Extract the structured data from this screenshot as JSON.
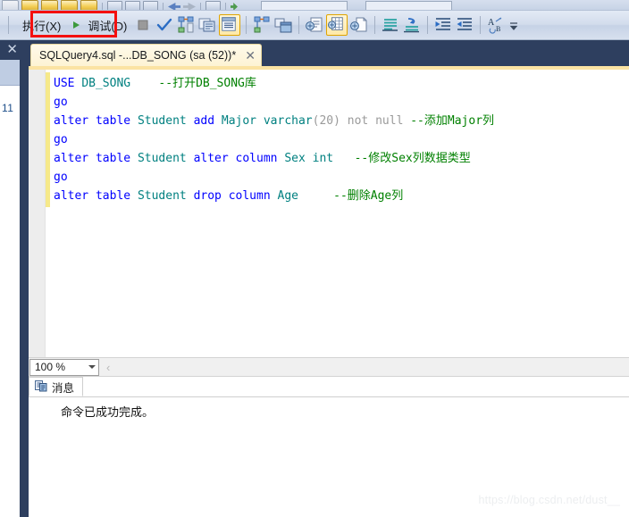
{
  "toolbar_top": {
    "icons": [
      "folder-gray-icon",
      "folder-open-icon",
      "folder-open-icon",
      "folder-open-icon",
      "save-icon",
      "window-icon",
      "window-split-icon",
      "navigate-back-icon",
      "navigate-forward-icon",
      "database-connect-icon",
      "green-dot-icon"
    ],
    "combo1_value": "",
    "combo2_value": ""
  },
  "toolbar": {
    "execute_label": "执行(X)",
    "execute_accesskey": "X",
    "execute_prefix": "执行(",
    "execute_suffix": ")",
    "debug_prefix": "调试(",
    "debug_accesskey": "D",
    "debug_suffix": ")",
    "debug_label": "调试(D)",
    "icons": [
      "stop-icon",
      "parse-check-icon",
      "display-estimated-plan-icon",
      "query-options-icon",
      "include-actual-plan-icon",
      "include-client-statistics-icon",
      "results-to-text-icon",
      "results-to-grid-icon",
      "results-to-file-icon",
      "comment-lines-icon",
      "uncomment-lines-icon",
      "decrease-indent-icon",
      "increase-indent-icon",
      "specify-values-icon",
      "toolbar-overflow-icon"
    ],
    "highlighted_icons": [
      "results-to-text-icon",
      "results-to-grid-icon"
    ]
  },
  "left_panel": {
    "close_label": "✕",
    "row_text": "11"
  },
  "tab": {
    "title": "SQLQuery4.sql -...DB_SONG (sa (52))*",
    "close_label": "✕"
  },
  "editor": {
    "lines": [
      [
        {
          "t": "USE ",
          "c": "kw"
        },
        {
          "t": "DB_SONG",
          "c": "idf"
        },
        {
          "t": "    ",
          "c": "plain"
        },
        {
          "t": "--打开DB_SONG库",
          "c": "cmt"
        }
      ],
      [
        {
          "t": "go",
          "c": "kw"
        }
      ],
      [
        {
          "t": "alter ",
          "c": "kw"
        },
        {
          "t": "table ",
          "c": "kw"
        },
        {
          "t": "Student ",
          "c": "idf"
        },
        {
          "t": "add ",
          "c": "kw"
        },
        {
          "t": "Major ",
          "c": "idf"
        },
        {
          "t": "varchar",
          "c": "idf"
        },
        {
          "t": "(20) ",
          "c": "gry"
        },
        {
          "t": "not null ",
          "c": "gry"
        },
        {
          "t": "--添加Major列",
          "c": "cmt"
        }
      ],
      [
        {
          "t": "go",
          "c": "kw"
        }
      ],
      [
        {
          "t": "alter ",
          "c": "kw"
        },
        {
          "t": "table ",
          "c": "kw"
        },
        {
          "t": "Student ",
          "c": "idf"
        },
        {
          "t": "alter ",
          "c": "kw"
        },
        {
          "t": "column ",
          "c": "kw"
        },
        {
          "t": "Sex ",
          "c": "idf"
        },
        {
          "t": "int ",
          "c": "idf"
        },
        {
          "t": "  ",
          "c": "plain"
        },
        {
          "t": "--修改Sex列数据类型",
          "c": "cmt"
        }
      ],
      [
        {
          "t": "go",
          "c": "kw"
        }
      ],
      [
        {
          "t": "alter ",
          "c": "kw"
        },
        {
          "t": "table ",
          "c": "kw"
        },
        {
          "t": "Student ",
          "c": "idf"
        },
        {
          "t": "drop ",
          "c": "kw"
        },
        {
          "t": "column ",
          "c": "kw"
        },
        {
          "t": "Age",
          "c": "idf"
        },
        {
          "t": "     ",
          "c": "plain"
        },
        {
          "t": "--删除Age列",
          "c": "cmt"
        }
      ]
    ]
  },
  "zoombar": {
    "zoom_value": "100 %",
    "chevron_left": "‹"
  },
  "results": {
    "tab_label": "消息",
    "tab_icon": "message-pane-icon",
    "message": "命令已成功完成。"
  },
  "watermark": {
    "text": "https://blog.csdn.net/dust__"
  },
  "colors": {
    "accent_red": "#f4100f",
    "tab_bg": "#fdf3d4",
    "tabstrip_bg": "#2e3f5f",
    "keyword": "#0000ff",
    "identifier": "#008080",
    "comment": "#008000",
    "gray_text": "#9a9a9a",
    "changebar": "#f6e98a"
  }
}
